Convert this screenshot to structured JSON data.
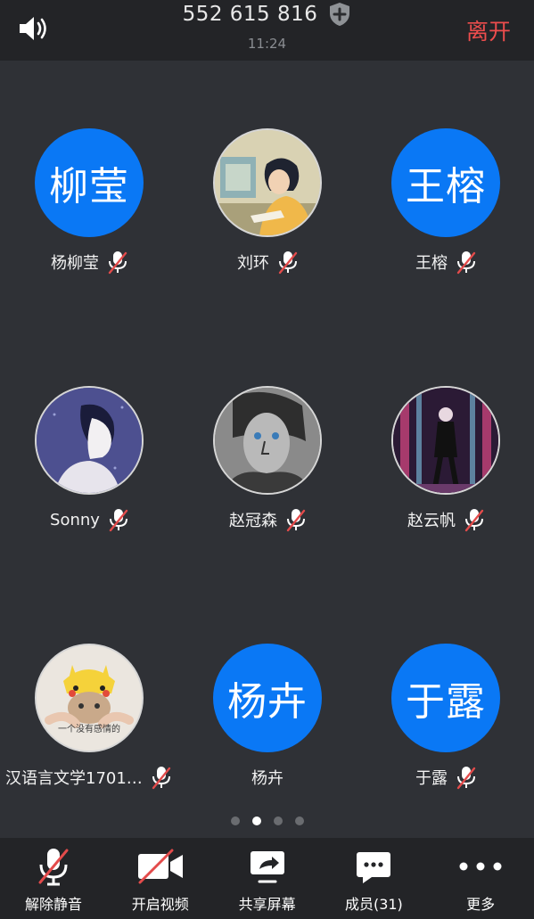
{
  "header": {
    "meeting_id": "552 615 816",
    "time": "11:24",
    "leave_label": "离开"
  },
  "participants": [
    {
      "name": "杨柳莹",
      "avatar_text": "柳莹",
      "muted": true
    },
    {
      "name": "刘环",
      "avatar_image": "anime-girl-desk-avatar",
      "muted": true
    },
    {
      "name": "王榕",
      "avatar_text": "王榕",
      "muted": true
    },
    {
      "name": "Sonny",
      "avatar_image": "woman-profile-illustration-avatar",
      "muted": true
    },
    {
      "name": "赵冠森",
      "avatar_image": "sketch-portrait-avatar",
      "muted": true
    },
    {
      "name": "赵云帆",
      "avatar_image": "singer-on-stage-avatar",
      "muted": true
    },
    {
      "name": "汉语言文学1701…",
      "avatar_image": "cat-pikachu-hat-avatar",
      "avatar_caption": "一个没有感情的",
      "muted": true
    },
    {
      "name": "杨卉",
      "avatar_text": "杨卉",
      "muted": false
    },
    {
      "name": "于露",
      "avatar_text": "于露",
      "muted": true
    }
  ],
  "pagination": {
    "pages": 4,
    "current": 2
  },
  "toolbar": {
    "unmute_label": "解除静音",
    "video_label": "开启视频",
    "share_label": "共享屏幕",
    "members_label": "成员(31)",
    "more_label": "更多"
  },
  "colors": {
    "background": "#2f3136",
    "bar": "#232427",
    "avatar_blue": "#0a78f5",
    "leave_red": "#ee4d4d",
    "muted_red": "#e34b4b"
  }
}
